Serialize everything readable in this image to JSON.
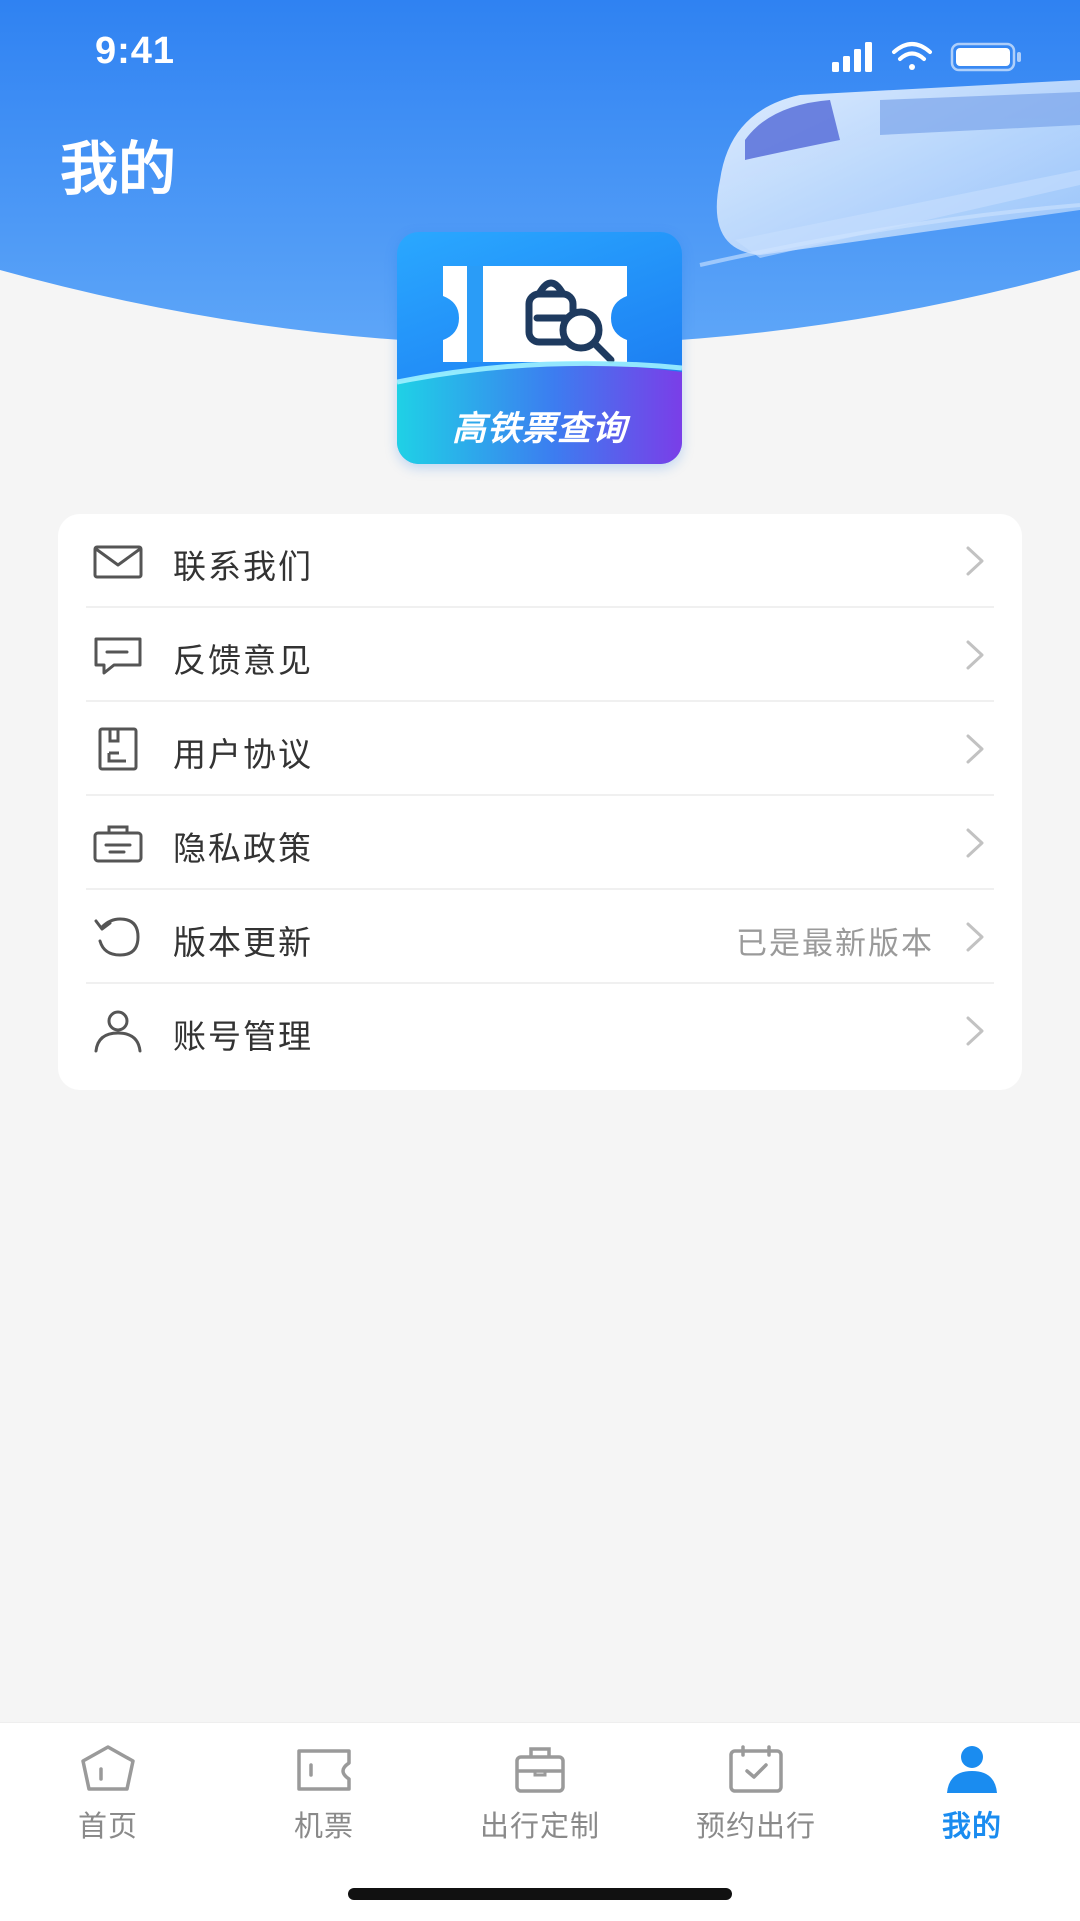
{
  "status_bar": {
    "time": "9:41"
  },
  "header": {
    "title": "我的"
  },
  "app_logo": {
    "text": "高铁票查询"
  },
  "menu": {
    "items": [
      {
        "label": "联系我们",
        "value": "",
        "icon": "mail-icon"
      },
      {
        "label": "反馈意见",
        "value": "",
        "icon": "feedback-icon"
      },
      {
        "label": "用户协议",
        "value": "",
        "icon": "document-icon"
      },
      {
        "label": "隐私政策",
        "value": "",
        "icon": "privacy-icon"
      },
      {
        "label": "版本更新",
        "value": "已是最新版本",
        "icon": "refresh-icon"
      },
      {
        "label": "账号管理",
        "value": "",
        "icon": "user-icon"
      }
    ]
  },
  "tab_bar": {
    "active": "我的",
    "tabs": [
      {
        "label": "首页",
        "icon": "home-icon"
      },
      {
        "label": "机票",
        "icon": "ticket-icon"
      },
      {
        "label": "出行定制",
        "icon": "suitcase-icon"
      },
      {
        "label": "预约出行",
        "icon": "calendar-check-icon"
      },
      {
        "label": "我的",
        "icon": "profile-icon"
      }
    ]
  },
  "colors": {
    "header_blue": "#3a8df5",
    "accent": "#1a8cf0",
    "background": "#f5f5f5",
    "text_primary": "#333333",
    "text_secondary": "#9a9a9a"
  }
}
